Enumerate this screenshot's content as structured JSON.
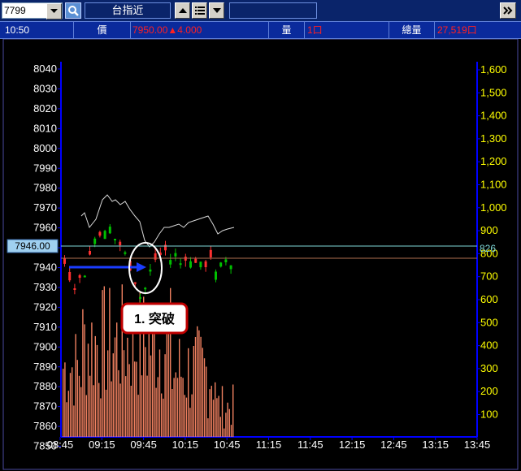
{
  "toolbar": {
    "code": "7799",
    "symbol": "台指近"
  },
  "info": {
    "time": "10:50",
    "price_label": "價",
    "price_value": "7950.00",
    "change_value": "4.000",
    "volume_label": "量",
    "volume_value": "1口",
    "total_label": "總量",
    "total_value": "27,519口"
  },
  "chart": {
    "price_ticks": [
      "8040",
      "8030",
      "8020",
      "8010",
      "8000",
      "7990",
      "7980",
      "7970",
      "7960",
      "7950",
      "7940",
      "7930",
      "7920",
      "7910",
      "7900",
      "7890",
      "7880",
      "7870",
      "7860",
      "7850"
    ],
    "volume_ticks": [
      "1,600",
      "1,500",
      "1,400",
      "1,300",
      "1,200",
      "1,100",
      "1,000",
      "900",
      "800",
      "700",
      "600",
      "500",
      "400",
      "300",
      "200",
      "100"
    ],
    "time_ticks": [
      "08:45",
      "09:15",
      "09:45",
      "10:15",
      "10:45",
      "11:15",
      "11:45",
      "12:15",
      "12:45",
      "13:15",
      "13:45"
    ],
    "current_price_tag": "7946.00",
    "current_volume_tag": "826",
    "annotation_label": "1. 突破"
  },
  "colors": {
    "price_axis": "#ffffff",
    "volume_axis": "#ffff00",
    "up_candle": "#ff3030",
    "down_candle": "#00c000",
    "volume_bar": "#f08060",
    "axis_line": "#0000ff",
    "price_line": "#7fd8d8",
    "annotation_border": "#c00000",
    "arrow": "#1a3dff"
  }
}
